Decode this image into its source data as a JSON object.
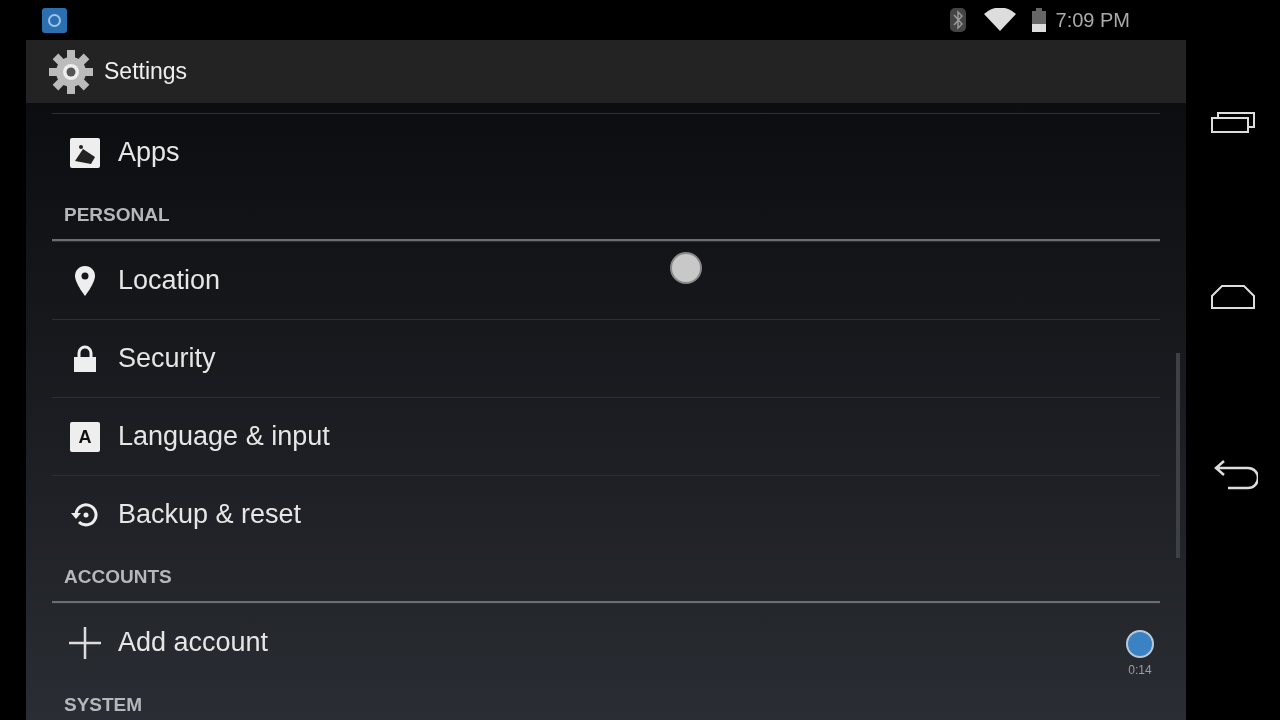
{
  "status_bar": {
    "time": "7:09 PM"
  },
  "action_bar": {
    "title": "Settings"
  },
  "list": [
    {
      "kind": "apps",
      "label": "Apps"
    },
    {
      "kind": "header",
      "label": "PERSONAL"
    },
    {
      "kind": "location",
      "label": "Location"
    },
    {
      "kind": "lock",
      "label": "Security"
    },
    {
      "kind": "language",
      "glyph": "A",
      "label": "Language & input"
    },
    {
      "kind": "backup",
      "label": "Backup & reset"
    },
    {
      "kind": "header",
      "label": "ACCOUNTS"
    },
    {
      "kind": "add",
      "label": "Add account"
    },
    {
      "kind": "header",
      "label": "SYSTEM"
    }
  ],
  "recorder": {
    "elapsed": "0:14"
  }
}
